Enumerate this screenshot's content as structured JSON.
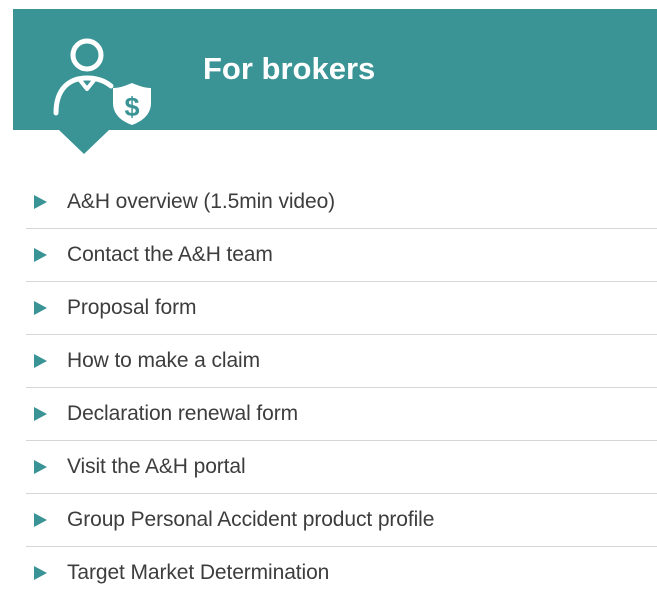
{
  "header": {
    "title": "For brokers",
    "icon": "broker-person-with-dollar-shield-icon",
    "background_color": "#3a9395",
    "title_color": "#ffffff"
  },
  "links": [
    {
      "label": "A&H overview (1.5min video)",
      "icon": "play-arrow-icon"
    },
    {
      "label": "Contact the A&H team",
      "icon": "play-arrow-icon"
    },
    {
      "label": "Proposal form",
      "icon": "play-arrow-icon"
    },
    {
      "label": "How to make a claim",
      "icon": "play-arrow-icon"
    },
    {
      "label": "Declaration renewal form",
      "icon": "play-arrow-icon"
    },
    {
      "label": "Visit the A&H portal",
      "icon": "play-arrow-icon"
    },
    {
      "label": "Group Personal Accident product profile",
      "icon": "play-arrow-icon"
    },
    {
      "label": "Target Market Determination",
      "icon": "play-arrow-icon"
    }
  ],
  "colors": {
    "accent": "#3a9395",
    "divider": "#d6d6d6",
    "link_text": "#3d3d3d"
  }
}
